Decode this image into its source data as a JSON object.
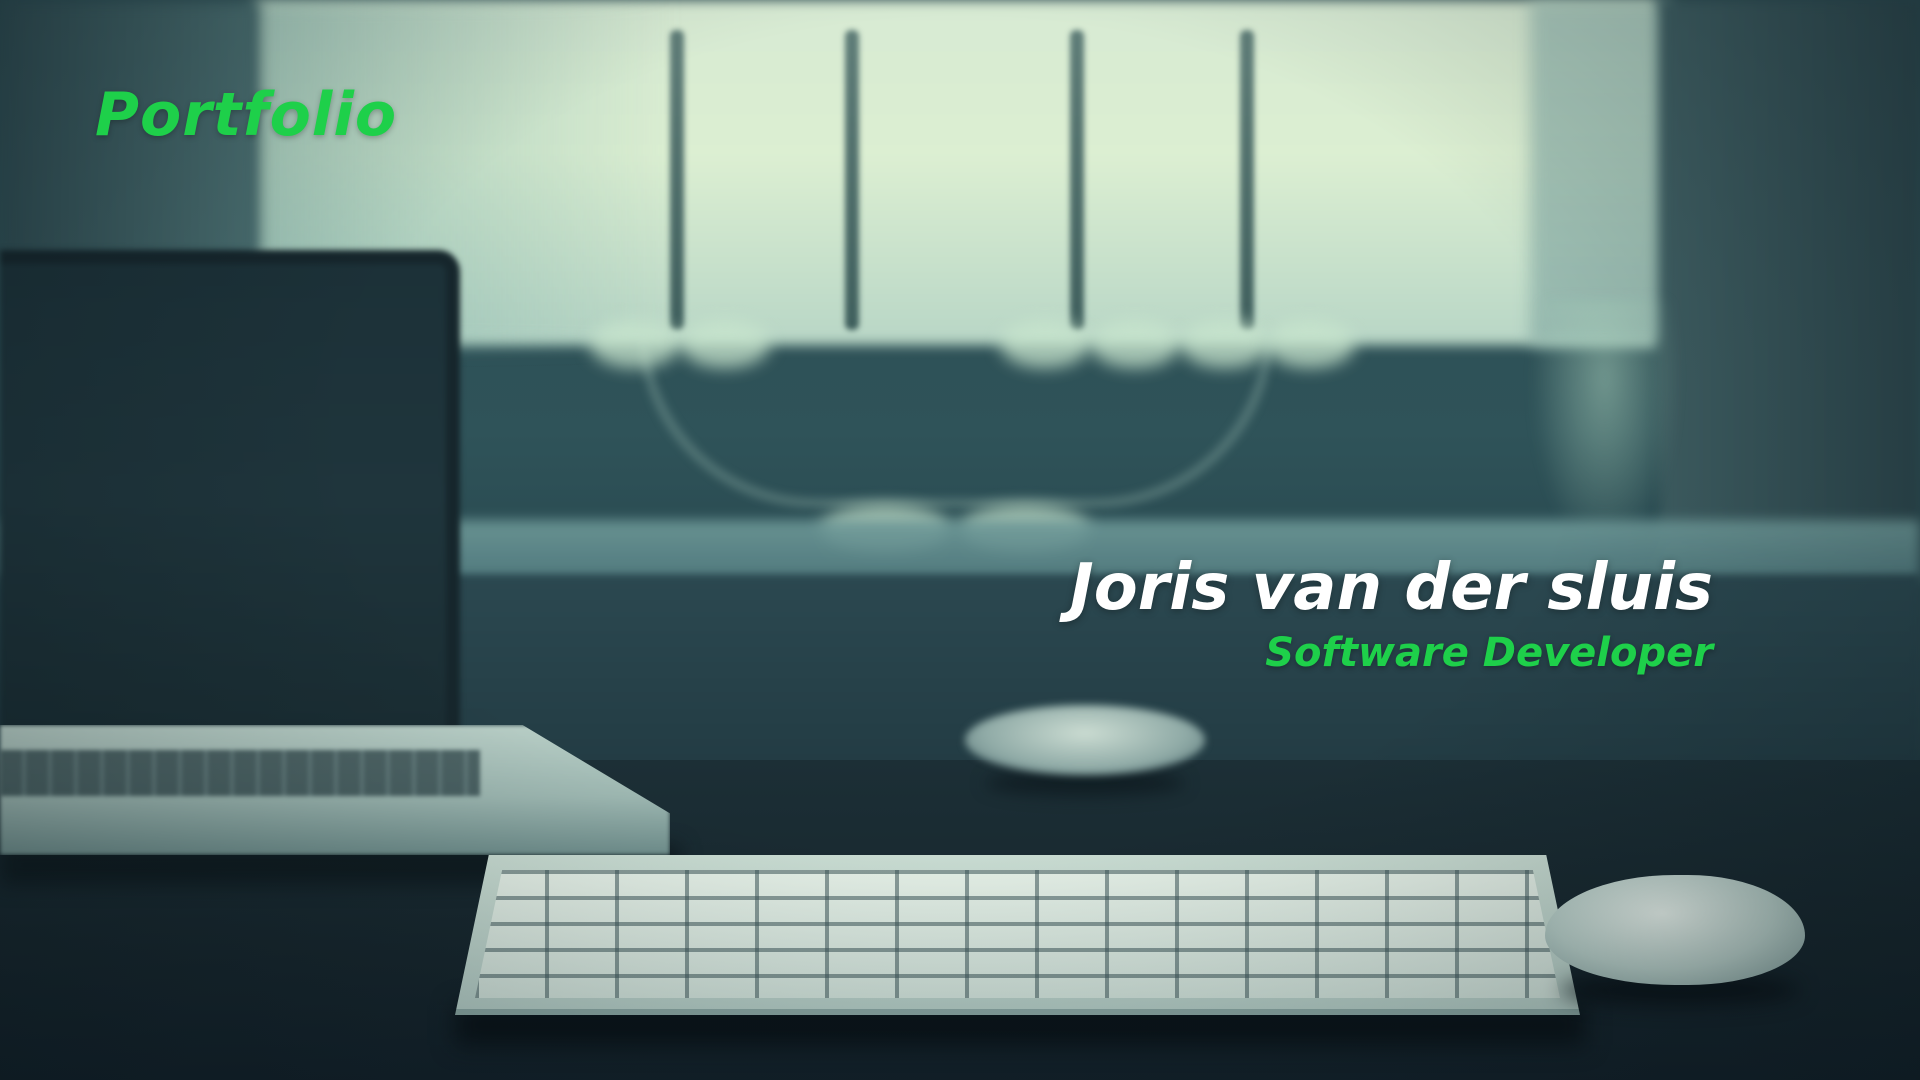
{
  "header": {
    "brand_label": "Portfolio"
  },
  "hero": {
    "name": "Joris van der sluis",
    "role": "Software Developer"
  },
  "colors": {
    "accent": "#1ED04A",
    "name_text": "#FFFFFF",
    "background_tint": "#2F5359"
  }
}
